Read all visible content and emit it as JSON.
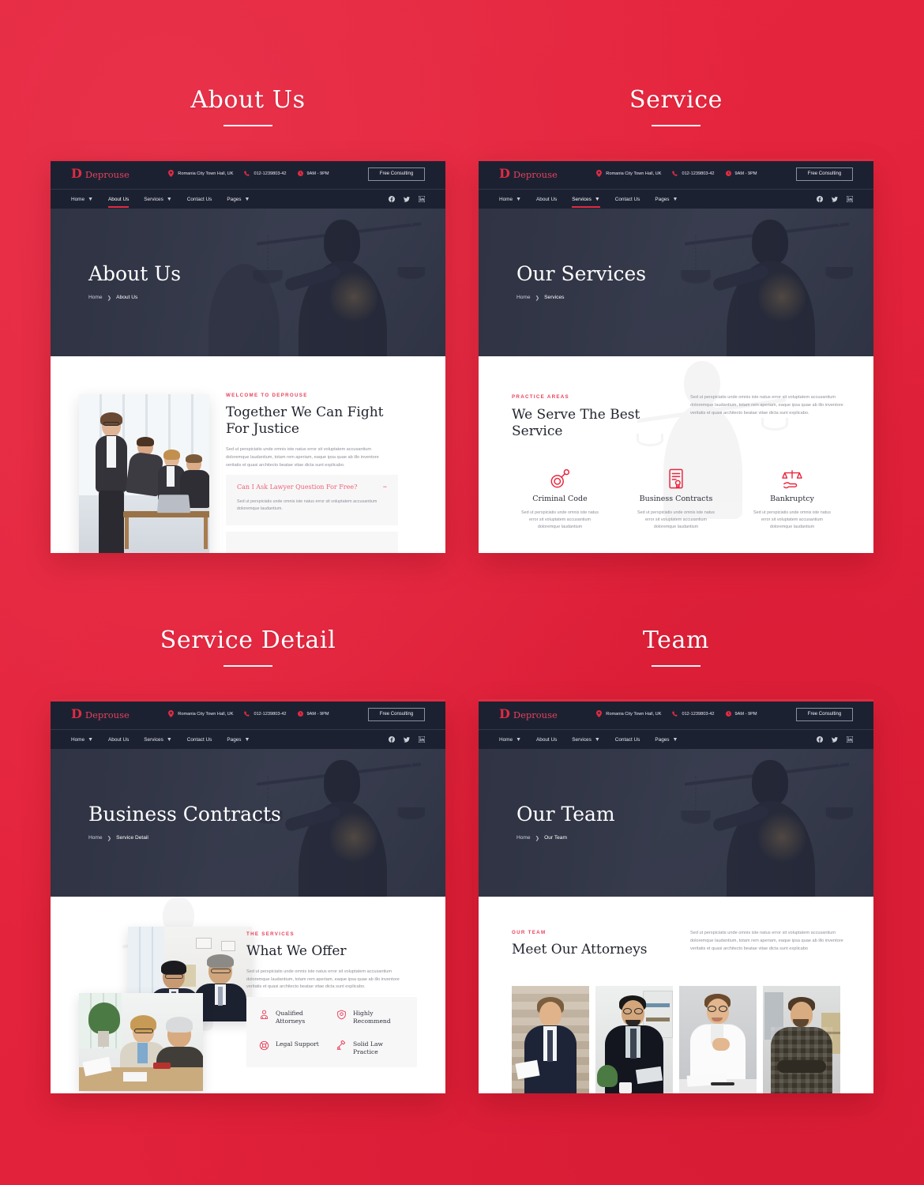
{
  "background_color": "#e4243c",
  "accent_color": "#e02b41",
  "dark_color": "#1c2132",
  "sections": [
    {
      "title": "About Us"
    },
    {
      "title": "Service"
    },
    {
      "title": "Service Detail"
    },
    {
      "title": "Team"
    }
  ],
  "site": {
    "brand": {
      "mark": "D",
      "word": "Deprouse"
    },
    "topbar": {
      "address": "Romania City Town Hall, UK",
      "phone": "012-1239803-42",
      "hours": "9AM - 9PM",
      "cta": "Free Consulting",
      "address_icon": "location-pin-icon",
      "phone_icon": "phone-icon",
      "hours_icon": "clock-icon"
    },
    "nav": [
      {
        "label": "Home",
        "has_dropdown": true
      },
      {
        "label": "About Us",
        "has_dropdown": false
      },
      {
        "label": "Services",
        "has_dropdown": true
      },
      {
        "label": "Contact Us",
        "has_dropdown": false
      },
      {
        "label": "Pages",
        "has_dropdown": true
      }
    ],
    "socials": [
      "facebook-icon",
      "twitter-icon",
      "linkedin-icon"
    ]
  },
  "about": {
    "active_nav": "About Us",
    "hero_title": "About Us",
    "breadcrumb_home": "Home",
    "breadcrumb_current": "About Us",
    "eyebrow": "WELCOME TO DEPROUSE",
    "title_line1": "Together We Can Fight",
    "title_line2": "For Justice",
    "paragraph": "Sed ut perspiciatis unde omnis iste natus error sit voluptatem accusantium doloremque laudantium, totam rem aperiam, eaque ipsa quae ab illo inventore veritatis et quasi architecto beatae vitae dicta sunt explicabo.",
    "accordion": {
      "question": "Can I Ask Lawyer Question For Free?",
      "sign": "−",
      "answer": "Sed ut perspiciatis unde omnis iste natus error sit voluptatem accusantium doloremque laudantium."
    }
  },
  "service": {
    "active_nav": "Services",
    "hero_title": "Our Services",
    "breadcrumb_home": "Home",
    "breadcrumb_current": "Services",
    "eyebrow": "PRACTICE AREAS",
    "title_line1": "We Serve The Best",
    "title_line2": "Service",
    "paragraph": "Sed ut perspiciatis unde omnis iste natus error sit voluptatem accusantium doloremque laudantium, totam rem aperiam, eaque ipsa quae ab illo inventore veritatis et quasi architecto beatae vitae dicta sunt explicabo.",
    "cards": [
      {
        "icon": "handcuff-icon",
        "title": "Criminal Code",
        "text": "Sed ut perspiciatis unde omnis iste natus error sit voluptatem accusantium doloremque laudantium"
      },
      {
        "icon": "certificate-icon",
        "title": "Business Contracts",
        "text": "Sed ut perspiciatis unde omnis iste natus error sit voluptatem accusantium doloremque laudantium"
      },
      {
        "icon": "scales-hand-icon",
        "title": "Bankruptcy",
        "text": "Sed ut perspiciatis unde omnis iste natus error sit voluptatem accusantium doloremque laudantium"
      }
    ]
  },
  "service_detail": {
    "active_nav": "Services",
    "hero_title": "Business Contracts",
    "breadcrumb_home": "Home",
    "breadcrumb_current": "Service Detail",
    "eyebrow": "THE SERVICES",
    "title": "What We Offer",
    "paragraph": "Sed ut perspiciatis unde omnis iste natus error sit voluptatem accusantium doloremque laudantium, totam rem aperiam, eaque ipsa quae ab illo inventore veritatis et quasi architecto beatae vitae dicta sunt explicabo.",
    "features": [
      {
        "icon": "attorney-icon",
        "label": "Qualified Attorneys"
      },
      {
        "icon": "badge-icon",
        "label": "Highly Recommend"
      },
      {
        "icon": "support-icon",
        "label": "Legal Support"
      },
      {
        "icon": "gavel-icon",
        "label": "Solid Law Practice"
      }
    ]
  },
  "team": {
    "active_nav": "Services",
    "hero_title": "Our Team",
    "breadcrumb_home": "Home",
    "breadcrumb_current": "Our Team",
    "eyebrow": "OUR TEAM",
    "title": "Meet Our Attorneys",
    "paragraph": "Sed ut perspiciatis unde omnis iste natus error sit voluptatem accusantium doloremque laudantium, totam rem aperiam, eaque ipsa quae ab illo inventore veritatis et quasi architecto beatae vitae dicta sunt explicabo",
    "members": [
      {
        "photo": "attorney-photo-1"
      },
      {
        "photo": "attorney-photo-2"
      },
      {
        "photo": "attorney-photo-3"
      },
      {
        "photo": "attorney-photo-4"
      }
    ]
  }
}
